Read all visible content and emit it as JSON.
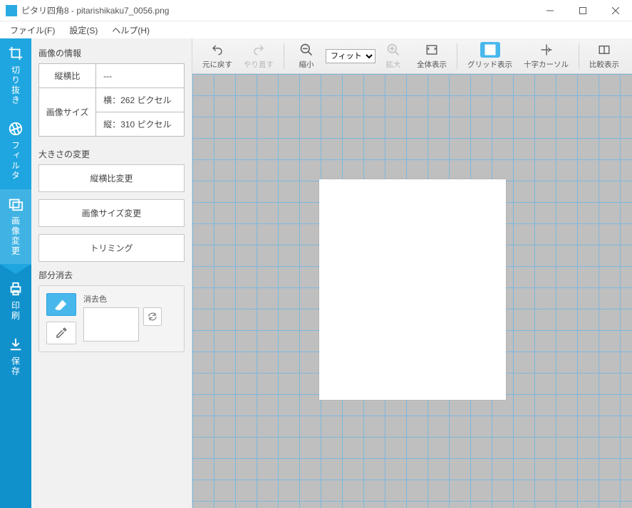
{
  "window": {
    "title": "ピタリ四角8 - pitarishikaku7_0056.png"
  },
  "menu": {
    "file": "ファイル(F)",
    "settings": "設定(S)",
    "help": "ヘルプ(H)"
  },
  "left_rail": {
    "crop": "切り抜き",
    "filter": "フィルタ",
    "image_edit": "画像変更",
    "print": "印刷",
    "save": "保存"
  },
  "side": {
    "info_title": "画像の情報",
    "aspect_label": "縦横比",
    "aspect_value": "---",
    "size_label": "画像サイズ",
    "width_label": "横：",
    "width_value": "262 ピクセル",
    "height_label": "縦：",
    "height_value": "310 ピクセル",
    "resize_title": "大きさの変更",
    "btn_aspect_change": "縦横比変更",
    "btn_size_change": "画像サイズ変更",
    "btn_trim": "トリミング",
    "erase_title": "部分消去",
    "erase_color_label": "消去色"
  },
  "toolbar": {
    "undo": "元に戻す",
    "redo": "やり直す",
    "zoom_out": "縮小",
    "fit_selected": "フィット",
    "zoom_in": "拡大",
    "full_view": "全体表示",
    "grid_view": "グリッド表示",
    "crosshair": "十字カーソル",
    "compare": "比較表示"
  }
}
